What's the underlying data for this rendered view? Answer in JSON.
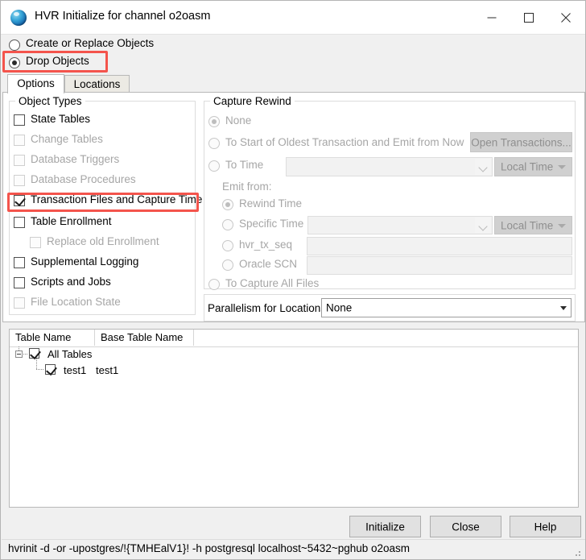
{
  "window": {
    "title": "HVR Initialize for channel o2oasm",
    "icon": "hvr-sphere-icon",
    "controls": {
      "minimize": "minimize-icon",
      "maximize": "maximize-icon",
      "close": "close-icon"
    }
  },
  "mode": {
    "options": [
      {
        "label": "Create or Replace Objects",
        "selected": false,
        "disabled": false
      },
      {
        "label": "Drop Objects",
        "selected": true,
        "disabled": false,
        "highlighted": true
      }
    ]
  },
  "tabs": [
    {
      "label": "Options",
      "active": true
    },
    {
      "label": "Locations",
      "active": false
    }
  ],
  "object_types": {
    "title": "Object Types",
    "items": [
      {
        "label": "State Tables",
        "checked": false,
        "disabled": false,
        "indent": 0
      },
      {
        "label": "Change Tables",
        "checked": false,
        "disabled": true,
        "indent": 0
      },
      {
        "label": "Database Triggers",
        "checked": false,
        "disabled": true,
        "indent": 0
      },
      {
        "label": "Database Procedures",
        "checked": false,
        "disabled": true,
        "indent": 0
      },
      {
        "label": "Transaction Files and Capture Time",
        "checked": true,
        "disabled": false,
        "indent": 0,
        "highlighted": true
      },
      {
        "label": "Table Enrollment",
        "checked": false,
        "disabled": false,
        "indent": 0
      },
      {
        "label": "Replace old Enrollment",
        "checked": false,
        "disabled": true,
        "indent": 1
      },
      {
        "label": "Supplemental Logging",
        "checked": false,
        "disabled": false,
        "indent": 0
      },
      {
        "label": "Scripts and Jobs",
        "checked": false,
        "disabled": false,
        "indent": 0
      },
      {
        "label": "File Location State",
        "checked": false,
        "disabled": true,
        "indent": 0
      }
    ]
  },
  "capture_rewind": {
    "title": "Capture Rewind",
    "none": {
      "label": "None",
      "selected": true,
      "disabled": true
    },
    "oldest": {
      "label": "To Start of Oldest Transaction and Emit from Now",
      "selected": false,
      "disabled": true
    },
    "open_transactions_button": {
      "label": "Open Transactions...",
      "disabled": true
    },
    "to_time": {
      "label": "To Time",
      "selected": false,
      "disabled": true,
      "value": "",
      "timezone": "Local Time"
    },
    "emit_from_label": "Emit from:",
    "emit_from": [
      {
        "label": "Rewind Time",
        "selected": true,
        "disabled": true
      },
      {
        "label": "Specific Time",
        "selected": false,
        "disabled": true,
        "value": "",
        "timezone": "Local Time"
      },
      {
        "label": "hvr_tx_seq",
        "selected": false,
        "disabled": true,
        "value": ""
      },
      {
        "label": "Oracle SCN",
        "selected": false,
        "disabled": true,
        "value": ""
      }
    ],
    "all_files": {
      "label": "To Capture All Files",
      "selected": false,
      "disabled": true
    }
  },
  "parallelism": {
    "label": "Parallelism for Locations",
    "value": "None",
    "disabled": false
  },
  "table_list": {
    "columns": [
      "Table Name",
      "Base Table Name"
    ],
    "rows": [
      {
        "table_name": "All Tables",
        "base_table_name": "",
        "checked": true,
        "level": 0,
        "expanded": true
      },
      {
        "table_name": "test1",
        "base_table_name": "test1",
        "checked": true,
        "level": 1,
        "expanded": false
      }
    ]
  },
  "buttons": [
    {
      "label": "Initialize",
      "name": "initialize-button"
    },
    {
      "label": "Close",
      "name": "close-button"
    },
    {
      "label": "Help",
      "name": "help-button"
    }
  ],
  "status": {
    "command": "hvrinit -d -or -upostgres/!{TMHEalV1}! -h postgresql localhost~5432~pghub o2oasm"
  },
  "colors": {
    "highlight": "#f4544c",
    "window_bg": "#f0f0f0",
    "panel_bg": "#ffffff",
    "disabled_text": "#a6a6a6"
  }
}
